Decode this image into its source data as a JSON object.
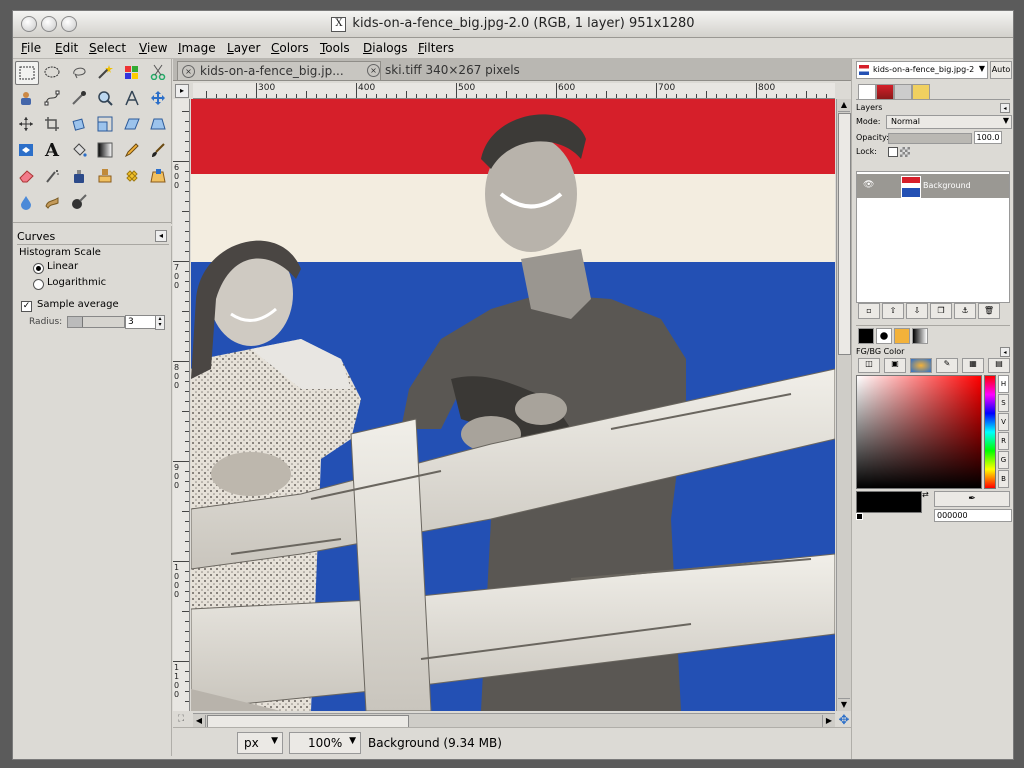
{
  "window": {
    "title": "kids-on-a-fence_big.jpg-2.0 (RGB, 1 layer) 951x1280"
  },
  "menu": [
    "File",
    "Edit",
    "Select",
    "View",
    "Image",
    "Layer",
    "Colors",
    "Tools",
    "Dialogs",
    "Filters"
  ],
  "tabs": [
    {
      "label": "kids-on-a-fence_big.jp..."
    },
    {
      "label": "ski.tiff 340×267 pixels"
    }
  ],
  "toolbox": {
    "tools": [
      "rect-select",
      "ellipse-select",
      "free-select",
      "fuzzy-select",
      "select-by-color",
      "scissors",
      "foreground-select",
      "paths",
      "color-picker",
      "zoom",
      "measure",
      "move",
      "align",
      "crop",
      "rotate",
      "scale",
      "shear",
      "perspective",
      "flip",
      "text",
      "bucket-fill",
      "blend",
      "pencil",
      "paintbrush",
      "eraser",
      "airbrush",
      "ink",
      "clone",
      "heal",
      "perspective-clone",
      "blur",
      "smudge",
      "dodge-burn"
    ]
  },
  "curves": {
    "title": "Curves",
    "histogram_scale_label": "Histogram Scale",
    "linear_label": "Linear",
    "logarithmic_label": "Logarithmic",
    "selected_scale": "Linear",
    "sample_average_label": "Sample average",
    "sample_average_checked": true,
    "radius_label": "Radius:",
    "radius_value": "3"
  },
  "ruler": {
    "h_labels": [
      "300",
      "400",
      "500",
      "600",
      "700",
      "800"
    ],
    "v_labels": [
      "600",
      "700",
      "800",
      "900",
      "1000",
      "1100"
    ]
  },
  "status": {
    "unit": "px",
    "zoom": "100%",
    "info": "Background (9.34 MB)"
  },
  "dock": {
    "image_select": "kids-on-a-fence_big.jpg-2",
    "auto_label": "Auto",
    "layers": {
      "title": "Layers",
      "mode_label": "Mode:",
      "mode_value": "Normal",
      "opacity_label": "Opacity:",
      "opacity_value": "100.0",
      "lock_label": "Lock:",
      "layer_name": "Background"
    },
    "fgbg": {
      "title": "FG/BG Color",
      "hex_value": "000000",
      "channels": [
        "H",
        "S",
        "V",
        "R",
        "G",
        "B"
      ]
    }
  },
  "colors": {
    "chrome": "#dcdad5",
    "flag_red": "#d61f2a",
    "flag_white": "#f3ede0",
    "flag_blue": "#2350b4"
  }
}
